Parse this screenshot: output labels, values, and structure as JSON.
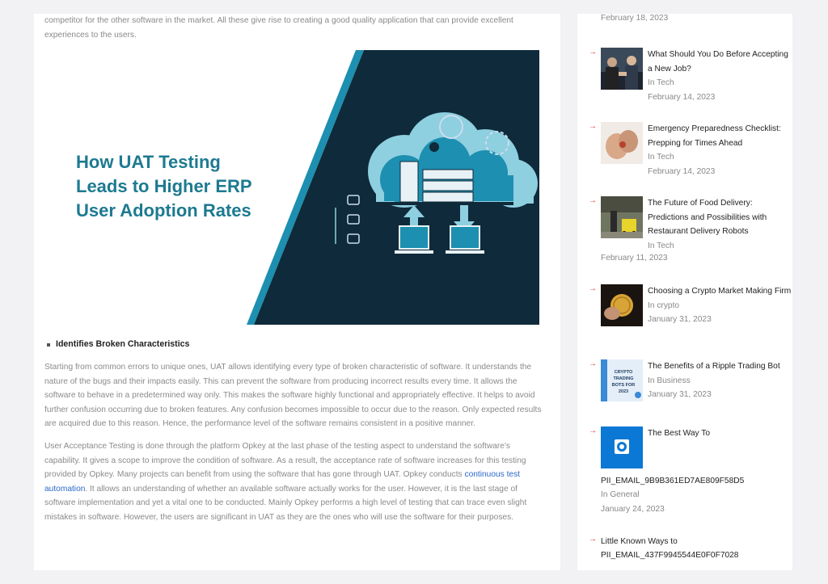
{
  "article": {
    "intro": "competitor for the other software in the market. All these give rise to creating a good quality application that can provide excellent experiences to the users.",
    "hero_title_lines": [
      "How UAT Testing",
      "Leads to Higher ERP",
      "User Adoption Rates"
    ],
    "bullet": "Identifies Broken Characteristics",
    "para1": "Starting from common errors to unique ones, UAT allows identifying every type of broken characteristic of software. It understands the nature of the bugs and their impacts easily. This can prevent the software from producing incorrect results every time. It allows the software to behave in a predetermined way only. This makes the software highly functional and appropriately effective. It helps to avoid further confusion occurring due to broken features. Any confusion becomes impossible to occur due to the reason. Only expected results are acquired due to this reason. Hence, the performance level of the software remains consistent in a positive manner.",
    "para2_before": "User Acceptance Testing is done through the platform Opkey at the last phase of the testing aspect to understand the software's capability. It gives a scope to improve the condition of software. As a result, the acceptance rate of software increases for this testing provided by Opkey. Many projects can benefit from using the software that has gone through UAT. Opkey conducts ",
    "para2_link": "continuous test automation",
    "para2_after": ". It allows an understanding of whether an available software actually works for the user. However, it is the last stage of software implementation and yet a vital one to be conducted. Mainly Opkey performs a high level of testing that can trace even slight mistakes in software. However, the users are significant in UAT as they are the ones who will use the software for their purposes."
  },
  "sidebar": {
    "top_date": "February 18, 2023",
    "posts": [
      {
        "title": "What Should You Do Before Accepting a New Job?",
        "category": "In Tech",
        "date": "February 14, 2023"
      },
      {
        "title": "Emergency Preparedness Checklist: Prepping for Times Ahead",
        "category": "In Tech",
        "date": "February 14, 2023"
      },
      {
        "title": "The Future of Food Delivery: Predictions and Possibilities with Restaurant Delivery Robots",
        "category": "In Tech",
        "date": "February 11, 2023"
      },
      {
        "title": "Choosing a Crypto Market Making Firm",
        "category": "In crypto",
        "date": "January 31, 2023"
      },
      {
        "title": "The Benefits of a Ripple Trading Bot",
        "category": "In Business",
        "date": "January 31, 2023",
        "thumb_text": "CRYPTO TRADING BOTS FOR 2023"
      },
      {
        "title": "The Best Way To",
        "title_cont": "PII_EMAIL_9B9B361ED7AE809F58D5",
        "category": "In General",
        "date": "January 24, 2023"
      },
      {
        "title": "Little Known Ways to",
        "title_cont": "PII_EMAIL_437F9945544E0F0F7028"
      }
    ]
  },
  "colors": {
    "accent": "#e0302a",
    "link": "#2a69c8",
    "hero_bg": "#0f2a3a",
    "hero_title": "#1d7a91"
  }
}
